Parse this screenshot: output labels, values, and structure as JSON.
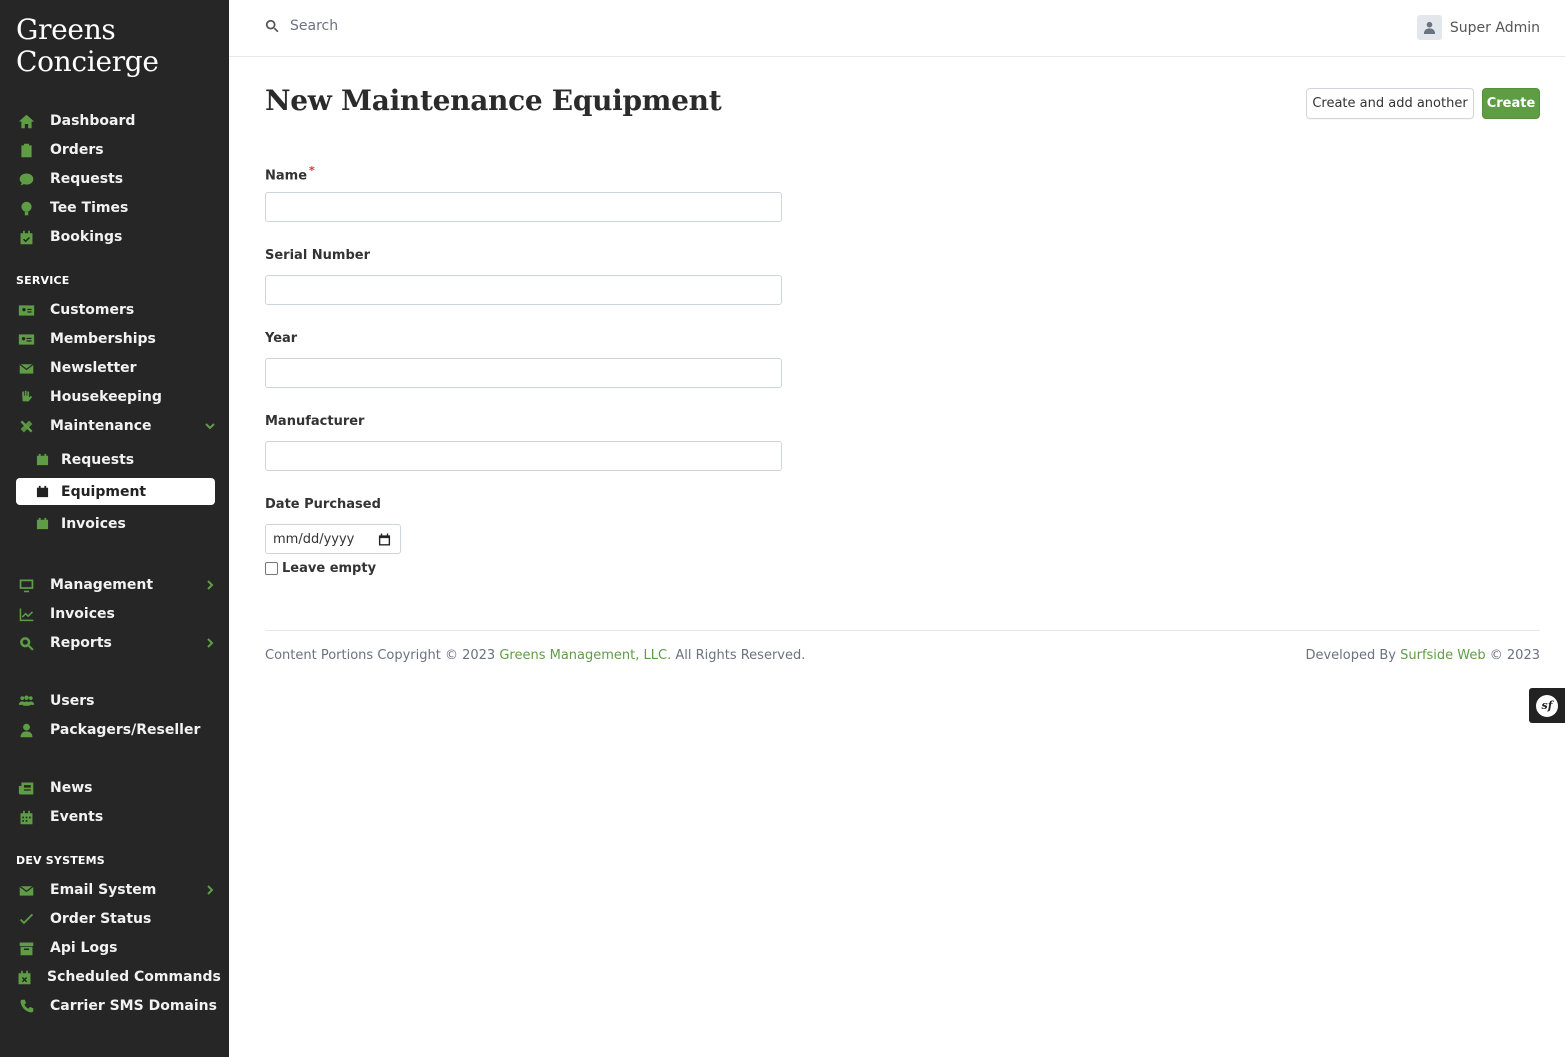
{
  "brand": {
    "line1": "Greens",
    "line2": "Concierge"
  },
  "sidebar": {
    "main_items": [
      {
        "label": "Dashboard",
        "icon": "home-icon"
      },
      {
        "label": "Orders",
        "icon": "clipboard-icon"
      },
      {
        "label": "Requests",
        "icon": "comment-dollar-icon"
      },
      {
        "label": "Tee Times",
        "icon": "golf-ball-icon"
      },
      {
        "label": "Bookings",
        "icon": "calendar-check-icon"
      }
    ],
    "service_title": "SERVICE",
    "service_items": [
      {
        "label": "Customers",
        "icon": "address-card-icon"
      },
      {
        "label": "Memberships",
        "icon": "id-card-icon"
      },
      {
        "label": "Newsletter",
        "icon": "envelope-icon"
      },
      {
        "label": "Housekeeping",
        "icon": "hand-sparkles-icon"
      },
      {
        "label": "Maintenance",
        "icon": "tools-icon"
      }
    ],
    "maintenance_sub": [
      {
        "label": "Requests",
        "icon": "calendar-icon"
      },
      {
        "label": "Equipment",
        "icon": "calendar-icon",
        "active": true
      },
      {
        "label": "Invoices",
        "icon": "calendar-icon"
      }
    ],
    "mgmt_items": [
      {
        "label": "Management",
        "icon": "desktop-icon"
      },
      {
        "label": "Invoices",
        "icon": "chart-line-icon"
      },
      {
        "label": "Reports",
        "icon": "search-dollar-icon"
      }
    ],
    "user_items": [
      {
        "label": "Users",
        "icon": "users-icon"
      },
      {
        "label": "Packagers/Reseller",
        "icon": "user-tie-icon"
      }
    ],
    "content_items": [
      {
        "label": "News",
        "icon": "newspaper-icon"
      },
      {
        "label": "Events",
        "icon": "calendar-alt-icon"
      }
    ],
    "dev_title": "DEV SYSTEMS",
    "dev_items": [
      {
        "label": "Email System",
        "icon": "envelope-icon"
      },
      {
        "label": "Order Status",
        "icon": "check-icon"
      },
      {
        "label": "Api Logs",
        "icon": "archive-icon"
      },
      {
        "label": "Scheduled Commands",
        "icon": "calendar-times-icon"
      },
      {
        "label": "Carrier SMS Domains",
        "icon": "phone-icon"
      }
    ]
  },
  "topbar": {
    "search_placeholder": "Search",
    "user_name": "Super Admin"
  },
  "page": {
    "title": "New Maintenance Equipment",
    "btn_create_another": "Create and add another",
    "btn_create": "Create"
  },
  "form": {
    "name_label": "Name",
    "name_required": "*",
    "serial_label": "Serial Number",
    "year_label": "Year",
    "manufacturer_label": "Manufacturer",
    "date_label": "Date Purchased",
    "date_placeholder": "mm/dd/yyyy",
    "leave_empty_label": "Leave empty"
  },
  "footer": {
    "left_prefix": "Content Portions Copyright © 2023 ",
    "left_link": "Greens Management, LLC.",
    "left_suffix": " All Rights Reserved.",
    "right_prefix": "Developed By ",
    "right_link": "Surfside Web",
    "right_suffix": " © 2023"
  },
  "symfony_badge": "sf",
  "colors": {
    "accent": "#5f9d45",
    "sidebar_bg": "#262626",
    "required": "#d9303e"
  }
}
